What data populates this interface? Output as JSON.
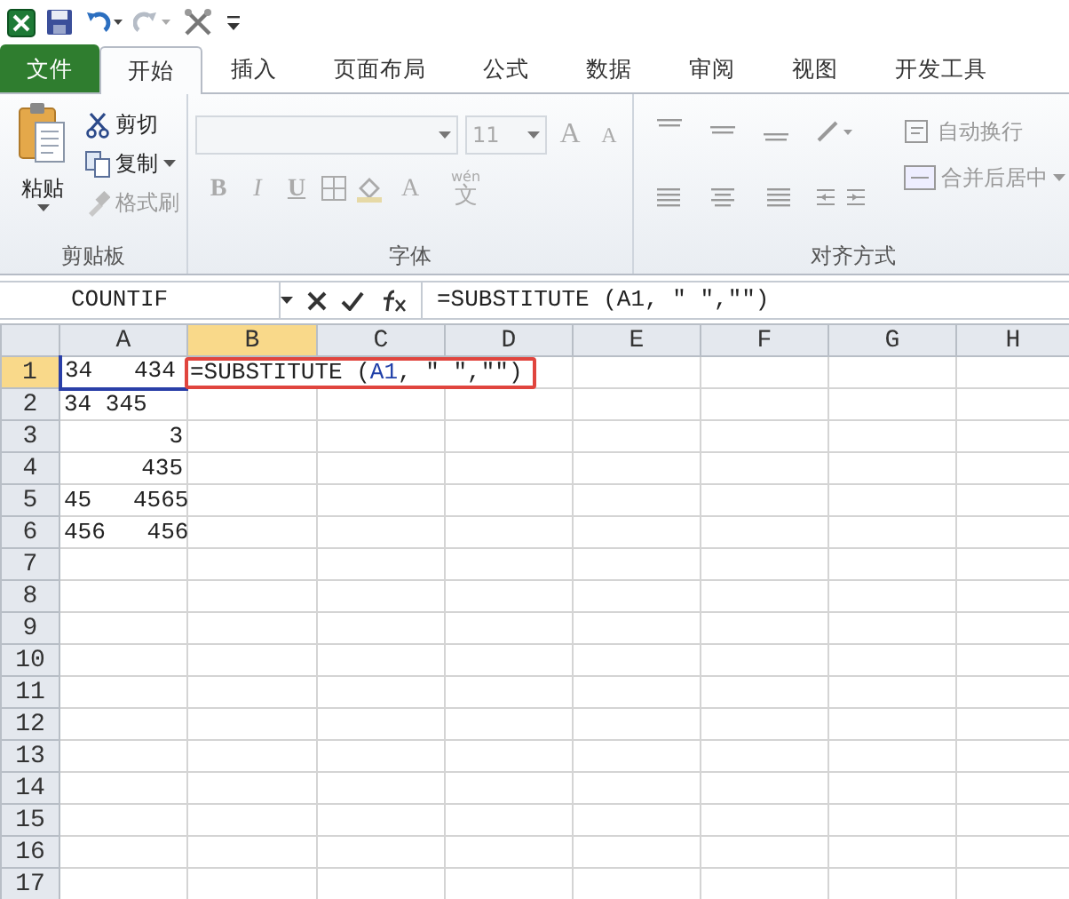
{
  "tabs": [
    {
      "label": "文件",
      "kind": "file",
      "selected": false
    },
    {
      "label": "开始",
      "kind": "tab",
      "selected": true
    },
    {
      "label": "插入",
      "kind": "tab",
      "selected": false
    },
    {
      "label": "页面布局",
      "kind": "tab",
      "selected": false
    },
    {
      "label": "公式",
      "kind": "tab",
      "selected": false
    },
    {
      "label": "数据",
      "kind": "tab",
      "selected": false
    },
    {
      "label": "审阅",
      "kind": "tab",
      "selected": false
    },
    {
      "label": "视图",
      "kind": "tab",
      "selected": false
    },
    {
      "label": "开发工具",
      "kind": "tab",
      "selected": false
    }
  ],
  "clipboard": {
    "label": "剪贴板",
    "paste": "粘贴",
    "items": [
      {
        "label": "剪切",
        "kind": "cut",
        "disabled": false,
        "dropdown": false
      },
      {
        "label": "复制",
        "kind": "copy",
        "disabled": false,
        "dropdown": true
      },
      {
        "label": "格式刷",
        "kind": "brush",
        "disabled": true,
        "dropdown": false
      }
    ]
  },
  "font": {
    "label": "字体",
    "size": "11",
    "disabled": true,
    "styles": [
      "B",
      "I",
      "U"
    ],
    "grow": "A",
    "shrink": "A",
    "color_letter": "A",
    "phonetic_top": "wén",
    "phonetic_bottom": "文"
  },
  "alignment": {
    "label": "对齐方式",
    "disabled": true,
    "wrap": "自动换行",
    "merge": "合并后居中"
  },
  "formula_bar": {
    "name_box": "COUNTIF",
    "formula": "=SUBSTITUTE (A1, \" \",\"\")"
  },
  "columns": [
    {
      "label": "A",
      "selected": false
    },
    {
      "label": "B",
      "selected": true
    },
    {
      "label": "C",
      "selected": false
    },
    {
      "label": "D",
      "selected": false
    },
    {
      "label": "E",
      "selected": false
    },
    {
      "label": "F",
      "selected": false
    },
    {
      "label": "G",
      "selected": false
    },
    {
      "label": "H",
      "selected": false
    }
  ],
  "rows": [
    {
      "label": "1",
      "selected": true,
      "a": "34   434",
      "kind": "text"
    },
    {
      "label": "2",
      "selected": false,
      "a": "34 345",
      "kind": "text"
    },
    {
      "label": "3",
      "selected": false,
      "a": "3",
      "kind": "number"
    },
    {
      "label": "4",
      "selected": false,
      "a": "435",
      "kind": "number"
    },
    {
      "label": "5",
      "selected": false,
      "a": "45   4565",
      "kind": "text"
    },
    {
      "label": "6",
      "selected": false,
      "a": "456   456",
      "kind": "text"
    },
    {
      "label": "7",
      "selected": false
    },
    {
      "label": "8",
      "selected": false
    },
    {
      "label": "9",
      "selected": false
    },
    {
      "label": "10",
      "selected": false
    },
    {
      "label": "11",
      "selected": false
    },
    {
      "label": "12",
      "selected": false
    },
    {
      "label": "13",
      "selected": false
    },
    {
      "label": "14",
      "selected": false
    },
    {
      "label": "15",
      "selected": false
    },
    {
      "label": "16",
      "selected": false
    },
    {
      "label": "17",
      "selected": false
    }
  ],
  "editing_cell": {
    "before": "=SUBSTITUTE (",
    "ref": "A1",
    "after": ", \" \",\"\")"
  }
}
